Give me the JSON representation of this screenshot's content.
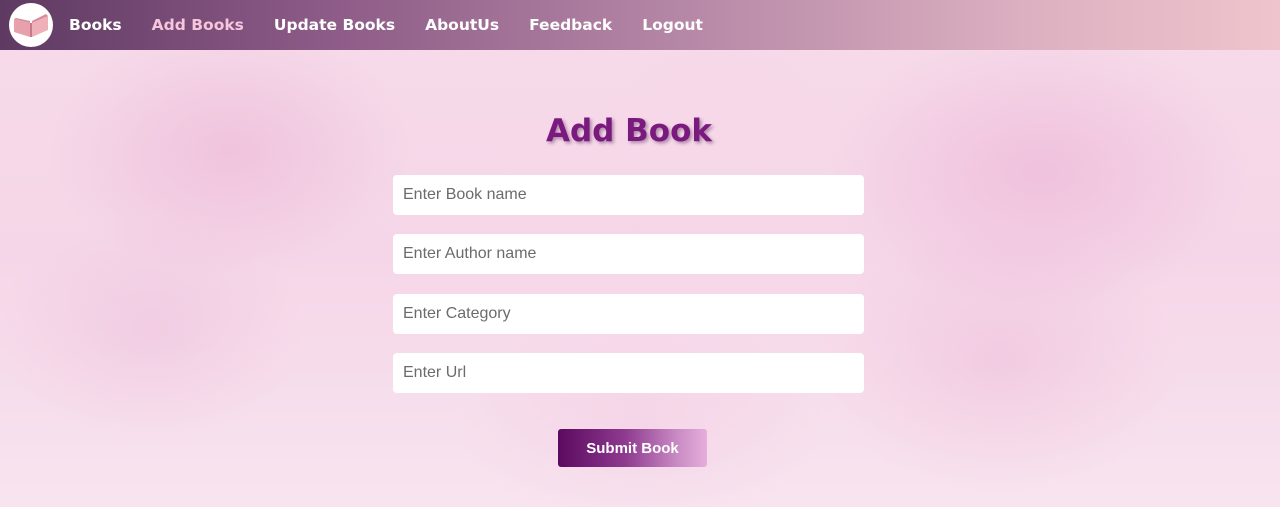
{
  "nav": {
    "logo_icon": "open-book-icon",
    "items": [
      {
        "label": "Books",
        "active": false
      },
      {
        "label": "Add Books",
        "active": true
      },
      {
        "label": "Update Books",
        "active": false
      },
      {
        "label": "AboutUs",
        "active": false
      },
      {
        "label": "Feedback",
        "active": false
      },
      {
        "label": "Logout",
        "active": false
      }
    ],
    "active_color": "#f7c6dc"
  },
  "form": {
    "title": "Add Book",
    "fields": [
      {
        "name": "book-name",
        "value": "",
        "placeholder": "Enter Book name"
      },
      {
        "name": "author-name",
        "value": "",
        "placeholder": "Enter Author name"
      },
      {
        "name": "category",
        "value": "",
        "placeholder": "Enter Category"
      },
      {
        "name": "url",
        "value": "",
        "placeholder": "Enter Url"
      }
    ],
    "submit_label": "Submit Book"
  },
  "colors": {
    "title": "#7a1a7e",
    "button_start": "#5a0a60",
    "button_end": "#e6aedb"
  }
}
